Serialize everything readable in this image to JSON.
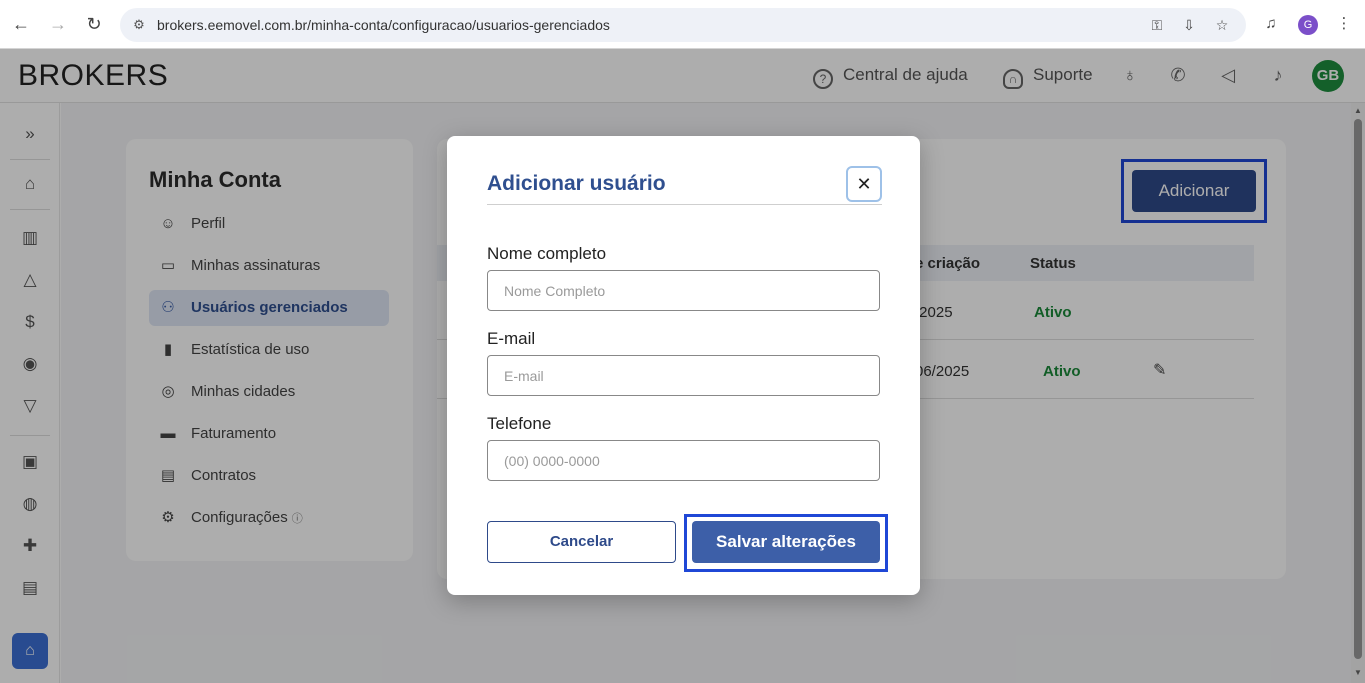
{
  "browser": {
    "url": "brokers.eemovel.com.br/minha-conta/configuracao/usuarios-gerenciados",
    "profile_initial": "G"
  },
  "header": {
    "logo": "BROKERS",
    "help_label": "Central de ajuda",
    "support_label": "Suporte",
    "avatar_initials": "GB",
    "avatar_color": "#1e8e3e"
  },
  "account_menu": {
    "title": "Minha Conta",
    "items": [
      {
        "label": "Perfil",
        "icon": "person-icon"
      },
      {
        "label": "Minhas assinaturas",
        "icon": "monitor-icon"
      },
      {
        "label": "Usuários gerenciados",
        "icon": "users-icon"
      },
      {
        "label": "Estatística de uso",
        "icon": "bar-chart-icon"
      },
      {
        "label": "Minhas cidades",
        "icon": "location-pin-icon"
      },
      {
        "label": "Faturamento",
        "icon": "credit-card-icon"
      },
      {
        "label": "Contratos",
        "icon": "clipboard-icon"
      },
      {
        "label": "Configurações",
        "icon": "gear-icon"
      }
    ]
  },
  "users_panel": {
    "add_button": "Adicionar",
    "columns": {
      "created": "e criação",
      "status": "Status"
    },
    "rows": [
      {
        "created": "/2025",
        "status": "Ativo"
      },
      {
        "created": "06/2025",
        "status": "Ativo"
      }
    ]
  },
  "modal": {
    "title": "Adicionar usuário",
    "close_symbol": "✕",
    "fields": {
      "name": {
        "label": "Nome completo",
        "placeholder": "Nome Completo"
      },
      "email": {
        "label": "E-mail",
        "placeholder": "E-mail"
      },
      "phone": {
        "label": "Telefone",
        "placeholder": "(00) 0000-0000"
      }
    },
    "cancel_label": "Cancelar",
    "save_label": "Salvar alterações"
  },
  "colors": {
    "accent": "#2e4a8a",
    "highlight_border": "#1f47d6",
    "status_active": "#1b8a3a"
  }
}
